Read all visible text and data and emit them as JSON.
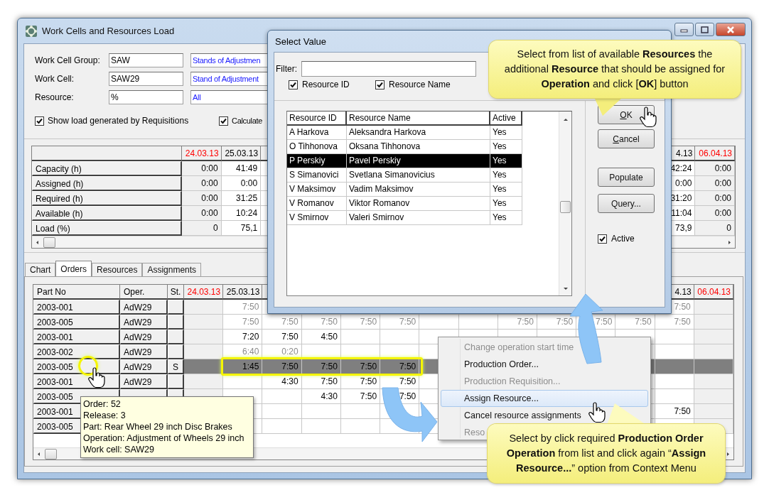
{
  "window": {
    "title": "Work Cells and Resources Load"
  },
  "filters": [
    {
      "label": "Work Cell Group:",
      "code": "SAW",
      "description": "Stands of Adjustmen"
    },
    {
      "label": "Work Cell:",
      "code": "SAW29",
      "description": "Stand of Adjustment"
    },
    {
      "label": "Resource:",
      "code": "%",
      "description": "All"
    }
  ],
  "options": [
    {
      "label": "Show load generated by Requisitions",
      "checked": true
    },
    {
      "label": "Calculate",
      "checked": true
    }
  ],
  "summary": {
    "days_left": [
      {
        "header": "24.03.13",
        "weekend": true
      },
      {
        "header": "25.03.13",
        "weekend": false
      }
    ],
    "days_right": [
      {
        "header": "4.13",
        "weekend": false
      },
      {
        "header": "06.04.13",
        "weekend": true
      }
    ],
    "rows": [
      {
        "label": "Capacity (h)",
        "cells": [
          "0:00",
          "41:49",
          null,
          null,
          null,
          null,
          null,
          null,
          null,
          null,
          null,
          null,
          "42:24",
          "0:00"
        ]
      },
      {
        "label": "Assigned (h)",
        "cells": [
          "0:00",
          "0:00",
          null,
          null,
          null,
          null,
          null,
          null,
          null,
          null,
          null,
          null,
          "0:00",
          "0:00"
        ]
      },
      {
        "label": "Required (h)",
        "cells": [
          "0:00",
          "31:25",
          null,
          null,
          null,
          null,
          null,
          null,
          null,
          null,
          null,
          null,
          "31:20",
          "0:00"
        ]
      },
      {
        "label": "Available (h)",
        "cells": [
          "0:00",
          "10:24",
          null,
          null,
          null,
          null,
          null,
          null,
          null,
          null,
          null,
          null,
          "11:04",
          "0:00"
        ]
      },
      {
        "label": "Load (%)",
        "cells": [
          "0",
          "75,1",
          null,
          null,
          null,
          null,
          null,
          null,
          null,
          null,
          null,
          null,
          "73,9",
          "0"
        ]
      }
    ]
  },
  "tabs": [
    {
      "label": "Chart",
      "selected": false
    },
    {
      "label": "Orders",
      "selected": true
    },
    {
      "label": "Resources",
      "selected": false
    },
    {
      "label": "Assignments",
      "selected": false
    }
  ],
  "orders": {
    "columns": [
      "Part No",
      "Oper.",
      "St."
    ],
    "days_left": [
      {
        "header": "24.03.13",
        "weekend": true
      },
      {
        "header": "25.03.13",
        "weekend": false
      }
    ],
    "days_right": [
      {
        "header": "4.13",
        "weekend": false
      },
      {
        "header": "06.04.13",
        "weekend": true
      }
    ],
    "rows": [
      {
        "part_no": "2003-001",
        "oper": "AdW29",
        "requisition": true,
        "selected": false,
        "cells": [
          null,
          "7:50",
          null,
          null,
          null,
          null,
          null,
          null,
          null,
          null,
          null,
          null,
          "7:50",
          null
        ]
      },
      {
        "part_no": "2003-005",
        "oper": "AdW29",
        "requisition": true,
        "selected": false,
        "cells": [
          null,
          "7:50",
          "7:50",
          "7:50",
          "7:50",
          "7:50",
          null,
          null,
          "7:50",
          "7:50",
          "7:50",
          "7:50",
          "7:50",
          null
        ]
      },
      {
        "part_no": "2003-001",
        "oper": "AdW29",
        "requisition": false,
        "selected": false,
        "cells": [
          null,
          "7:20",
          "7:50",
          "4:50",
          null,
          null,
          null,
          null,
          null,
          null,
          null,
          null,
          null,
          null
        ]
      },
      {
        "part_no": "2003-002",
        "oper": "AdW29",
        "requisition": true,
        "selected": false,
        "cells": [
          null,
          "6:40",
          "0:20",
          null,
          null,
          null,
          null,
          null,
          null,
          null,
          null,
          null,
          null,
          null
        ]
      },
      {
        "part_no": "2003-005",
        "oper": "AdW29",
        "status": "S",
        "requisition": false,
        "selected": true,
        "cells": [
          null,
          "1:45",
          "7:50",
          "7:50",
          "7:50",
          "7:50",
          null,
          null,
          null,
          null,
          null,
          null,
          null,
          null
        ]
      },
      {
        "part_no": "2003-001",
        "oper": "AdW29",
        "requisition": false,
        "selected": false,
        "cells": [
          null,
          null,
          "4:30",
          "7:50",
          "7:50",
          "7:50",
          null,
          null,
          null,
          null,
          null,
          null,
          null,
          null
        ]
      },
      {
        "part_no": "2003-005",
        "requisition": false,
        "selected": false,
        "cells": [
          null,
          null,
          null,
          "4:30",
          "7:50",
          "7:50",
          null,
          null,
          null,
          null,
          null,
          null,
          null,
          null
        ]
      },
      {
        "part_no": "2003-001",
        "requisition": false,
        "selected": false,
        "cells": [
          null,
          null,
          null,
          null,
          null,
          null,
          null,
          null,
          null,
          null,
          null,
          null,
          "7:50",
          null
        ]
      },
      {
        "part_no": "2003-005",
        "requisition": false,
        "selected": false,
        "cells": [
          null,
          null,
          null,
          null,
          null,
          null,
          null,
          null,
          null,
          null,
          null,
          null,
          null,
          null
        ]
      }
    ]
  },
  "tooltip": {
    "lines": [
      "Order: 52",
      "Release: 3",
      "Part: Rear Wheel 29 inch Disc Brakes",
      "Operation: Adjustment of Wheels 29 inch",
      "Work cell: SAW29"
    ]
  },
  "dialog": {
    "title": "Select Value",
    "filter_label": "Filter:",
    "search_in": [
      {
        "label": "Resource ID",
        "checked": true
      },
      {
        "label": "Resource Name",
        "checked": true
      }
    ],
    "columns": [
      "Resource ID",
      "Resource Name",
      "Active"
    ],
    "rows": [
      {
        "id": "A Harkova",
        "name": "Aleksandra Harkova",
        "active": "Yes",
        "selected": false
      },
      {
        "id": "O Tihhonova",
        "name": "Oksana Tihhonova",
        "active": "Yes",
        "selected": false
      },
      {
        "id": "P Perskiy",
        "name": "Pavel Perskiy",
        "active": "Yes",
        "selected": true
      },
      {
        "id": "S Simanovici",
        "name": "Svetlana Simanovicius",
        "active": "Yes",
        "selected": false
      },
      {
        "id": "V Maksimov",
        "name": "Vadim Maksimov",
        "active": "Yes",
        "selected": false
      },
      {
        "id": "V Romanov",
        "name": "Viktor Romanov",
        "active": "Yes",
        "selected": false
      },
      {
        "id": "V Smirnov",
        "name": "Valeri Smirnov",
        "active": "Yes",
        "selected": false
      }
    ],
    "buttons": [
      {
        "label": "OK",
        "mnemonic": true
      },
      {
        "label": "Cancel",
        "mnemonic": true
      },
      {
        "label": "Populate",
        "mnemonic": false
      },
      {
        "label": "Query...",
        "mnemonic": false
      }
    ],
    "active_only": {
      "label": "Active",
      "checked": true
    }
  },
  "context_menu": [
    {
      "label": "Change operation start time",
      "disabled": true,
      "hovered": false
    },
    {
      "label": "Production Order...",
      "disabled": false,
      "hovered": false
    },
    {
      "label": "Production Requisition...",
      "disabled": true,
      "hovered": false
    },
    {
      "label": "Assign Resource...",
      "disabled": false,
      "hovered": true
    },
    {
      "label": "Cancel resource assignments",
      "disabled": false,
      "hovered": false
    },
    {
      "label": "Reso",
      "disabled": true,
      "hovered": false
    }
  ],
  "callouts": [
    {
      "text": "Select from list of available **Resources** the additional **Resource** that should be assigned for **Operation** and click [**OK**] button"
    },
    {
      "text": "Select by click required **Production Order Operation** from list and click again “**Assign Resource...**” option from Context Menu"
    }
  ]
}
